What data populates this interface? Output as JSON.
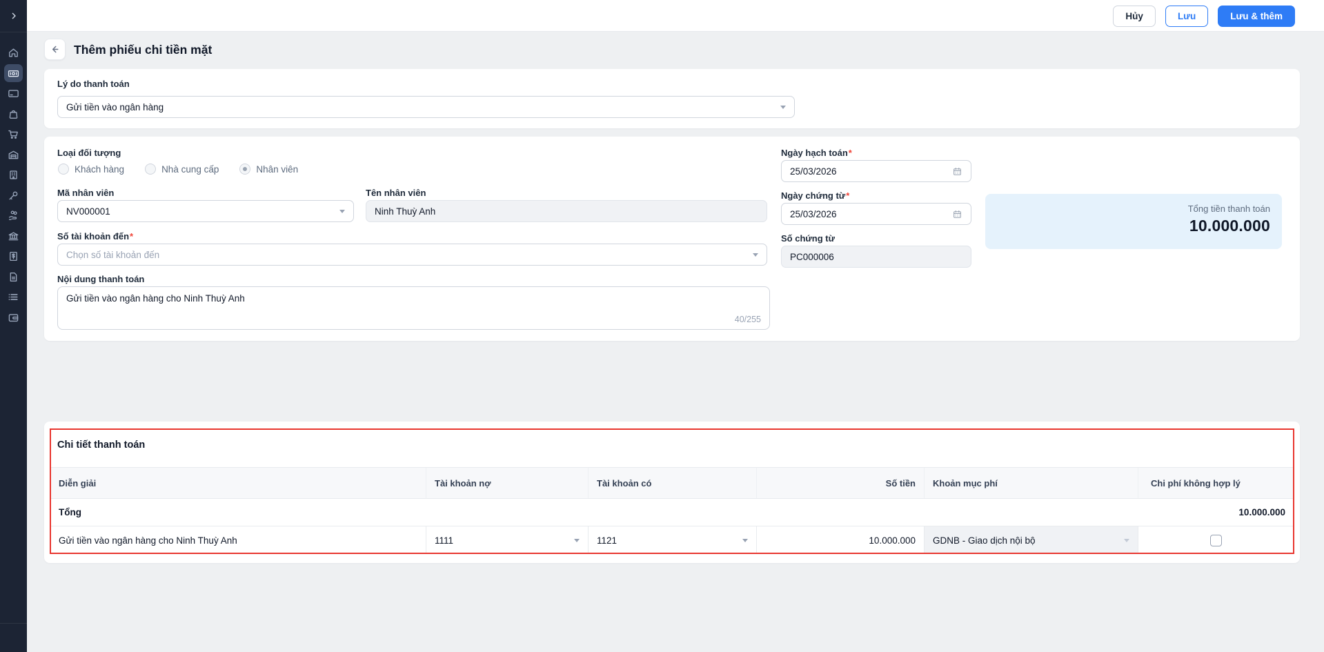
{
  "colors": {
    "accent": "#2e7cf6",
    "sidebar_bg": "#1c2434",
    "annotation_red": "#e8352e",
    "total_panel_bg": "#e5f2fc"
  },
  "sidebar": {
    "expand_icon": "chevron-right",
    "items": [
      {
        "name": "home",
        "active": false
      },
      {
        "name": "cash",
        "active": true
      },
      {
        "name": "credit-card",
        "active": false
      },
      {
        "name": "shopping-bag",
        "active": false
      },
      {
        "name": "shopping-cart",
        "active": false
      },
      {
        "name": "warehouse",
        "active": false
      },
      {
        "name": "building",
        "active": false
      },
      {
        "name": "tools",
        "active": false
      },
      {
        "name": "hand-coins",
        "active": false
      },
      {
        "name": "bank",
        "active": false
      },
      {
        "name": "invoice",
        "active": false
      },
      {
        "name": "document",
        "active": false
      },
      {
        "name": "list",
        "active": false
      },
      {
        "name": "wallet",
        "active": false
      }
    ],
    "settings_icon": "gear"
  },
  "topbar": {
    "cancel": "Hủy",
    "save": "Lưu",
    "save_and_add": "Lưu & thêm"
  },
  "page": {
    "title": "Thêm phiếu chi tiền mặt"
  },
  "reason_card": {
    "label": "Lý do thanh toán",
    "value": "Gửi tiền vào ngân hàng"
  },
  "info_card": {
    "object_type": {
      "label": "Loại đối tượng",
      "options": [
        {
          "label": "Khách hàng",
          "selected": false
        },
        {
          "label": "Nhà cung cấp",
          "selected": false
        },
        {
          "label": "Nhân viên",
          "selected": true
        }
      ]
    },
    "employee_code": {
      "label": "Mã nhân viên",
      "value": "NV000001"
    },
    "employee_name": {
      "label": "Tên nhân viên",
      "value": "Ninh Thuỳ Anh"
    },
    "account_to": {
      "label": "Số tài khoản đến",
      "required": "*",
      "placeholder": "Chọn số tài khoản đến"
    },
    "content": {
      "label": "Nội dung thanh toán",
      "value": "Gửi tiền vào ngân hàng cho Ninh Thuỳ Anh",
      "counter": "40/255"
    },
    "posting_date": {
      "label": "Ngày hạch toán",
      "required": "*",
      "value": "25/03/2026"
    },
    "document_date": {
      "label": "Ngày chứng từ",
      "required": "*",
      "value": "25/03/2026"
    },
    "document_number": {
      "label": "Số chứng từ",
      "value": "PC000006"
    },
    "total_panel": {
      "label": "Tổng tiền thanh toán",
      "amount": "10.000.000"
    }
  },
  "detail_card": {
    "title": "Chi tiết thanh toán",
    "columns": [
      "Diễn giải",
      "Tài khoản nợ",
      "Tài khoản có",
      "Số tiền",
      "Khoản mục phí",
      "Chi phí không hợp lý"
    ],
    "total_row": {
      "label": "Tổng",
      "amount": "10.000.000"
    },
    "row": {
      "description": "Gửi tiền vào ngân hàng cho Ninh Thuỳ Anh",
      "debit_account": "1111",
      "credit_account": "1121",
      "amount": "10.000.000",
      "fee_category": "GDNB - Giao dịch nội bộ",
      "invalid_expense_checked": false
    }
  }
}
